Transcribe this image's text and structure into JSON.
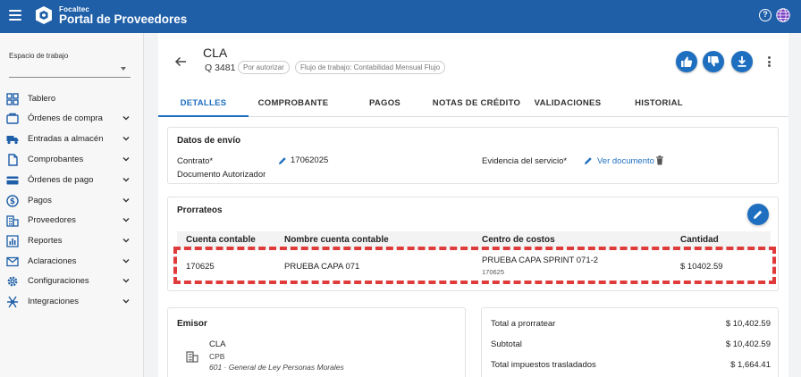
{
  "header": {
    "brand_small": "Focaltec",
    "brand_title": "Portal de Proveedores",
    "help_symbol": "?"
  },
  "colors": {
    "primary": "#1f5fa8",
    "accent": "#1f6fc0",
    "highlight": "#e03b3b"
  },
  "sidebar": {
    "workspace_label": "Espacio de trabajo",
    "workspace_value": "",
    "items": [
      {
        "label": "Tablero",
        "icon": "dashboard-icon",
        "expandable": false
      },
      {
        "label": "Órdenes de compra",
        "icon": "cart-icon",
        "expandable": true
      },
      {
        "label": "Entradas a almacén",
        "icon": "truck-icon",
        "expandable": true
      },
      {
        "label": "Comprobantes",
        "icon": "document-icon",
        "expandable": true
      },
      {
        "label": "Órdenes de pago",
        "icon": "card-icon",
        "expandable": true
      },
      {
        "label": "Pagos",
        "icon": "dollar-icon",
        "expandable": true
      },
      {
        "label": "Proveedores",
        "icon": "building-icon",
        "expandable": true
      },
      {
        "label": "Reportes",
        "icon": "report-icon",
        "expandable": true
      },
      {
        "label": "Aclaraciones",
        "icon": "mail-icon",
        "expandable": true
      },
      {
        "label": "Configuraciones",
        "icon": "gear-icon",
        "expandable": true
      },
      {
        "label": "Integraciones",
        "icon": "integration-icon",
        "expandable": true
      }
    ]
  },
  "document": {
    "title": "CLA",
    "number": "Q 3481",
    "status_chip": "Por autorizar",
    "workflow_chip": "Flujo de trabajo: Contabilidad Mensual Flujo"
  },
  "tabs": [
    {
      "label": "DETALLES",
      "active": true
    },
    {
      "label": "COMPROBANTE",
      "active": false
    },
    {
      "label": "PAGOS",
      "active": false
    },
    {
      "label": "NOTAS DE CRÉDITO",
      "active": false
    },
    {
      "label": "VALIDACIONES",
      "active": false
    },
    {
      "label": "HISTORIAL",
      "active": false
    }
  ],
  "envio": {
    "title": "Datos de envío",
    "contrato_label": "Contrato*",
    "contrato_value": "17062025",
    "documento_label": "Documento Autorizador",
    "evidencia_label": "Evidencia del servicio*",
    "ver_documento": "Ver documento"
  },
  "prorrateos": {
    "title": "Prorrateos",
    "columns": [
      "Cuenta contable",
      "Nombre cuenta contable",
      "Centro de costos",
      "Cantidad"
    ],
    "rows": [
      {
        "cuenta": "170625",
        "nombre": "PRUEBA CAPA 071",
        "centro": "PRUEBA CAPA SPRINT 071-2",
        "centro_code": "170625",
        "cantidad": "$ 10402.59"
      }
    ]
  },
  "emisor": {
    "title": "Emisor",
    "name": "CLA",
    "code": "CPB",
    "regimen": "601 · General de Ley Personas Morales"
  },
  "totales": [
    {
      "label": "Total a prorratear",
      "value": "$ 10,402.59"
    },
    {
      "label": "Subtotal",
      "value": "$ 10,402.59"
    },
    {
      "label": "Total impuestos trasladados",
      "value": "$ 1,664.41"
    }
  ]
}
